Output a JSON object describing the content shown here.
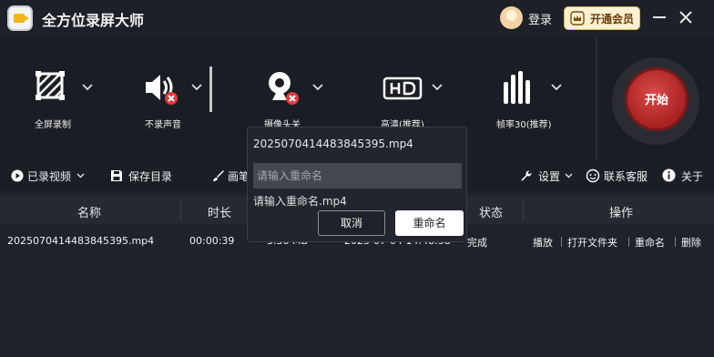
{
  "app": {
    "title": "全方位录屏大师",
    "login_label": "登录",
    "vip_label": "开通会员"
  },
  "toolbar": {
    "items": [
      {
        "label": "全屏录制",
        "icon": "fullscreen-area-icon"
      },
      {
        "label": "不录声音",
        "icon": "speaker-muted-icon"
      },
      {
        "label": "摄像头关",
        "icon": "webcam-off-icon"
      },
      {
        "label": "高清(推荐)",
        "icon": "hd-icon"
      },
      {
        "label": "帧率30(推荐)",
        "icon": "framerate-bars-icon"
      }
    ],
    "start_label": "开始",
    "accent_color": "#c62c2c"
  },
  "subbar": {
    "recorded_label": "已录视频",
    "save_dir_label": "保存目录",
    "brush_label": "画笔",
    "settings_label": "设置",
    "support_label": "联系客服",
    "about_label": "关于"
  },
  "table": {
    "headers": [
      "名称",
      "时长",
      "状态",
      "操作"
    ],
    "rows": [
      {
        "name": "20250704144838453​95.mp4",
        "duration": "00:00:39",
        "size": "3.36 MB",
        "created": "2025-07-04 14:48:58",
        "status": "完成",
        "actions": [
          "播放",
          "打开文件夹",
          "重命名",
          "删除"
        ]
      }
    ]
  },
  "dialog": {
    "title": "20250704144838453​95.mp4",
    "input_placeholder": "请输入重命名",
    "hint": "请输入重命名.mp4",
    "cancel_label": "取消",
    "rename_label": "重命名"
  }
}
